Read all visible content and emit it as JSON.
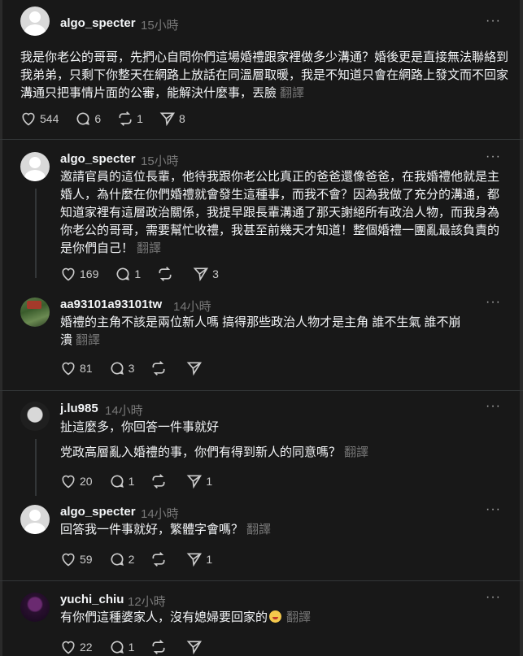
{
  "posts": [
    {
      "username": "algo_specter",
      "time": "15小時",
      "more": "···",
      "text": "我是你老公的哥哥，先捫心自問你們這場婚禮跟家裡做多少溝通？婚後更是直接無法聯絡到我弟弟，只剩下你整天在網路上放話在同溫層取暖，我是不知道只會在網路上發文而不回家溝通只把事情片面的公審，能解決什麼事，丟臉",
      "translate": "翻譯",
      "likes": "544",
      "replies": "6",
      "reposts": "1",
      "shares": "8"
    },
    {
      "username": "algo_specter",
      "time": "15小時",
      "more": "···",
      "text": "邀請官員的這位長輩，他待我跟你老公比真正的爸爸還像爸爸，在我婚禮他就是主婚人，為什麼在你們婚禮就會發生這種事，而我不會？因為我做了充分的溝通，都知道家裡有這層政治關係，我提早跟長輩溝通了那天謝絕所有政治人物，而我身為你老公的哥哥，需要幫忙收禮，我甚至前幾天才知道！整個婚禮一團亂最該負責的是你們自己！",
      "translate": "翻譯",
      "likes": "169",
      "replies": "1",
      "reposts": "",
      "shares": "3"
    },
    {
      "username": "aa93101a93101tw",
      "time": "14小時",
      "more": "···",
      "text": "婚禮的主角不該是兩位新人嗎 搞得那些政治人物才是主角 誰不生氣 誰不崩潰",
      "translate": "翻譯",
      "likes": "81",
      "replies": "3",
      "reposts": "",
      "shares": ""
    },
    {
      "username": "j.lu985",
      "time": "14小時",
      "more": "···",
      "text": "扯這麼多，你回答一件事就好",
      "text2": "党政高層亂入婚禮的事，你們有得到新人的同意嗎？",
      "translate": "翻譯",
      "likes": "20",
      "replies": "1",
      "reposts": "",
      "shares": "1"
    },
    {
      "username": "algo_specter",
      "time": "14小時",
      "more": "···",
      "text": "回答我一件事就好，繁體字會嗎？",
      "translate": "翻譯",
      "likes": "59",
      "replies": "2",
      "reposts": "",
      "shares": "1"
    },
    {
      "username": "yuchi_chiu",
      "time": "12小時",
      "more": "···",
      "text": "有你們這種婆家人，沒有媳婦要回家的",
      "translate": "翻譯",
      "likes": "22",
      "replies": "1",
      "reposts": "",
      "shares": ""
    }
  ]
}
